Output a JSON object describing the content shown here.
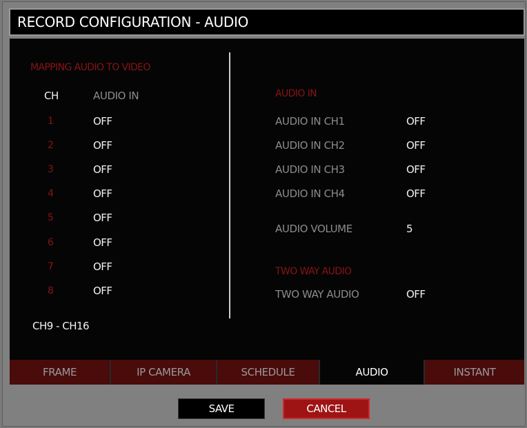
{
  "title": "RECORD CONFIGURATION - AUDIO",
  "mapping": {
    "heading": "MAPPING AUDIO TO VIDEO",
    "col_ch": "CH",
    "col_audio_in": "AUDIO IN",
    "rows": [
      {
        "ch": "1",
        "value": "OFF"
      },
      {
        "ch": "2",
        "value": "OFF"
      },
      {
        "ch": "3",
        "value": "OFF"
      },
      {
        "ch": "4",
        "value": "OFF"
      },
      {
        "ch": "5",
        "value": "OFF"
      },
      {
        "ch": "6",
        "value": "OFF"
      },
      {
        "ch": "7",
        "value": "OFF"
      },
      {
        "ch": "8",
        "value": "OFF"
      }
    ],
    "page_link": "CH9 - CH16"
  },
  "audio_in": {
    "heading": "AUDIO IN",
    "items": [
      {
        "label": "AUDIO IN CH1",
        "value": "OFF"
      },
      {
        "label": "AUDIO IN CH2",
        "value": "OFF"
      },
      {
        "label": "AUDIO IN CH3",
        "value": "OFF"
      },
      {
        "label": "AUDIO IN CH4",
        "value": "OFF"
      }
    ],
    "volume_label": "AUDIO VOLUME",
    "volume_value": "5"
  },
  "two_way": {
    "heading": "TWO WAY AUDIO",
    "label": "TWO WAY AUDIO",
    "value": "OFF"
  },
  "tabs": [
    {
      "label": "FRAME",
      "active": false
    },
    {
      "label": "IP CAMERA",
      "active": false
    },
    {
      "label": "SCHEDULE",
      "active": false
    },
    {
      "label": "AUDIO",
      "active": true
    },
    {
      "label": "INSTANT",
      "active": false
    }
  ],
  "buttons": {
    "save": "SAVE",
    "cancel": "CANCEL"
  },
  "colors": {
    "accent_red": "#8a1313",
    "tab_red": "#4a0b0b",
    "cancel_red": "#9e1414"
  }
}
